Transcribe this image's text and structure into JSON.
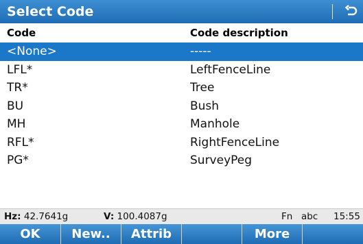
{
  "title": "Select Code",
  "columns": {
    "code": "Code",
    "description": "Code description"
  },
  "rows": [
    {
      "code": "<None>",
      "description": "-----"
    },
    {
      "code": "LFL*",
      "description": "LeftFenceLine"
    },
    {
      "code": "TR*",
      "description": "Tree"
    },
    {
      "code": "BU",
      "description": "Bush"
    },
    {
      "code": "MH",
      "description": "Manhole"
    },
    {
      "code": "RFL*",
      "description": "RightFenceLine"
    },
    {
      "code": "PG*",
      "description": "SurveyPeg"
    }
  ],
  "selected_row": 0,
  "status": {
    "hz_label": "Hz:",
    "hz_value": "42.7641g",
    "v_label": "V:",
    "v_value": "100.4087g",
    "fn": "Fn",
    "input_mode": "abc",
    "time": "15:55"
  },
  "fkeys": {
    "f1": "OK",
    "f2": "New..",
    "f3": "Attrib",
    "f4": "",
    "f5": "More",
    "f6": ""
  },
  "icons": {
    "back": "back-arrow-icon"
  },
  "colors": {
    "accent": "#1b78c9",
    "titlebar": "#2a7cc4",
    "statusbar": "#e9e9e9"
  }
}
